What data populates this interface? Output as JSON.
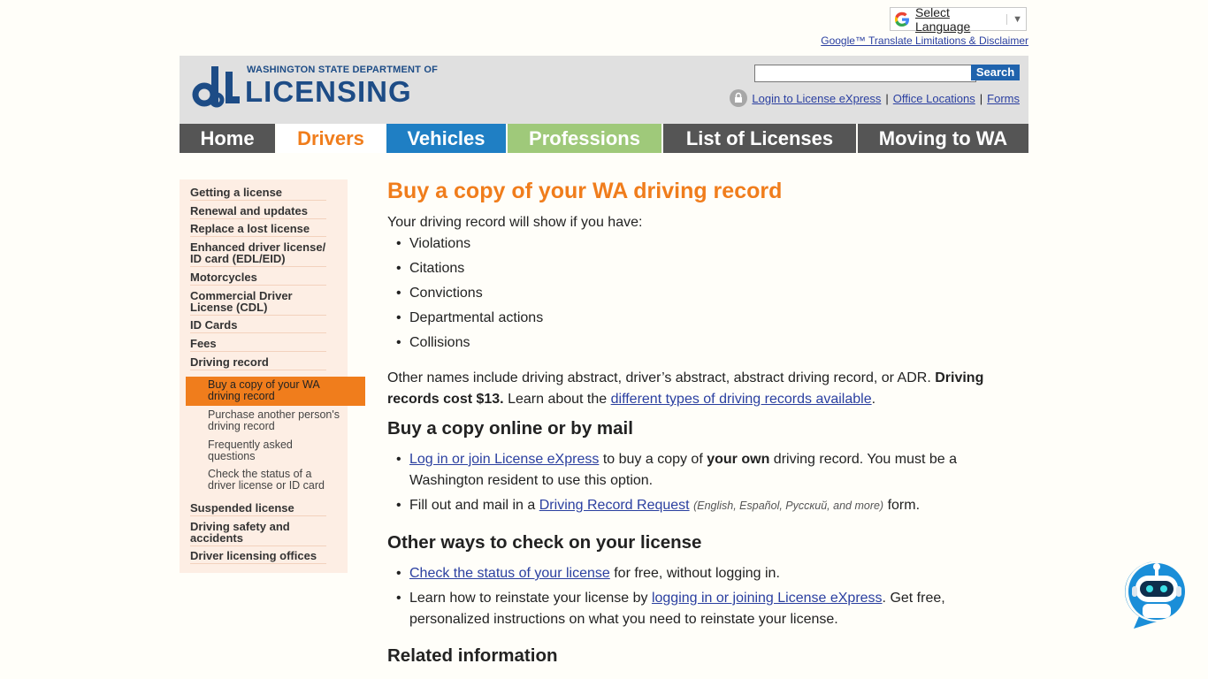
{
  "translate": {
    "label": "Select Language",
    "caret": "▼",
    "disclaimer": "Google™ Translate Limitations & Disclaimer"
  },
  "header": {
    "logo_small": "WASHINGTON STATE DEPARTMENT OF",
    "logo_big": "LICENSING",
    "search_placeholder": "",
    "search_button": "Search",
    "login_link": "Login to License eXpress",
    "office_link": "Office Locations",
    "forms_link": "Forms",
    "sep": "|"
  },
  "nav": {
    "tabs": [
      {
        "label": "Home",
        "bg": "#555555",
        "fg": "#ffffff"
      },
      {
        "label": "Drivers",
        "bg": "#ffffff",
        "fg": "#f07d1c"
      },
      {
        "label": "Vehicles",
        "bg": "#1f7fc4",
        "fg": "#ffffff"
      },
      {
        "label": "Professions",
        "bg": "#9fc97a",
        "fg": "#ffffff"
      },
      {
        "label": "List of Licenses",
        "bg": "#555555",
        "fg": "#ffffff"
      },
      {
        "label": "Moving to WA",
        "bg": "#555555",
        "fg": "#ffffff"
      }
    ]
  },
  "sidebar": {
    "items": [
      "Getting a license",
      "Renewal and updates",
      "Replace a lost license",
      "Enhanced driver license/ ID card (EDL/EID)",
      "Motorcycles",
      "Commercial Driver License (CDL)",
      "ID Cards",
      "Fees",
      "Driving record"
    ],
    "subitems": {
      "active": "Buy a copy of your WA driving record",
      "purchase": "Purchase another person's driving record",
      "faq": "Frequently asked questions",
      "status": "Check the status of a driver license or ID card"
    },
    "items_after": [
      "Suspended license",
      "Driving safety and accidents",
      "Driver licensing offices"
    ]
  },
  "main": {
    "title": "Buy a copy of your WA driving record",
    "intro": "Your driving record will show if you have:",
    "list": [
      "Violations",
      "Citations",
      "Convictions",
      "Departmental actions",
      "Collisions"
    ],
    "para_a": "Other names include driving abstract, driver’s abstract, abstract driving record, or ADR.",
    "para_bold": "Driving records cost $13.",
    "para_b": "Learn about the",
    "para_link": "different types of driving records available",
    "para_end": ".",
    "h2_buy": "Buy a copy online or by mail",
    "buy1_link": "Log in or join License eXpress",
    "buy1_a": "to buy a copy of",
    "buy1_bold": "your own",
    "buy1_b": "driving record. You must be a Washington resident to use this option.",
    "buy2_a": "Fill out and mail in a",
    "buy2_link": "Driving Record Request",
    "buy2_small": "(English, Español, Русский, and more)",
    "buy2_b": "form.",
    "h2_other": "Other ways to check on your license",
    "other1_link": "Check the status of your license",
    "other1_a": "for free, without logging in.",
    "other2_a": "Learn how to reinstate your license by",
    "other2_link": "logging in or joining License eXpress",
    "other2_b": ". Get free, personalized instructions on what you need to reinstate your license.",
    "h2_related": "Related information"
  }
}
